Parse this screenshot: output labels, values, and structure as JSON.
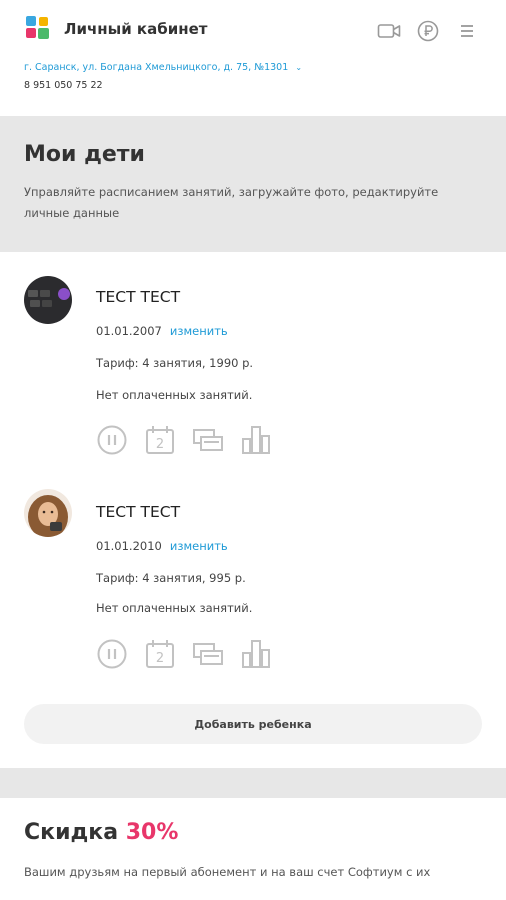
{
  "header": {
    "title": "Личный кабинет",
    "address": "г. Саранск, ул. Богдана Хмельницкого, д. 75, №1301",
    "phone": "8 951 050 75 22"
  },
  "hero": {
    "title": "Мои дети",
    "description": "Управляйте расписанием занятий, загружайте фото, редактируйте личные данные"
  },
  "children": [
    {
      "name": "ТЕСТ ТЕСТ",
      "dob": "01.01.2007",
      "edit_label": "изменить",
      "tariff": "Тариф: 4 занятия, 1990 р.",
      "paid_status": "Нет оплаченных занятий."
    },
    {
      "name": "ТЕСТ ТЕСТ",
      "dob": "01.01.2010",
      "edit_label": "изменить",
      "tariff": "Тариф: 4 занятия, 995 р.",
      "paid_status": "Нет оплаченных занятий."
    }
  ],
  "action_icons": [
    "pause-icon",
    "calendar-icon",
    "cards-icon",
    "stats-icon"
  ],
  "add_child_label": "Добавить ребенка",
  "discount": {
    "title": "Скидка",
    "percent": "30%",
    "text": "Вашим друзьям на первый абонемент и на ваш счет Софтиум с их"
  },
  "colors": {
    "accent_link": "#1e9ad6",
    "discount_accent": "#e8366a",
    "band": "#e7e7e7"
  }
}
